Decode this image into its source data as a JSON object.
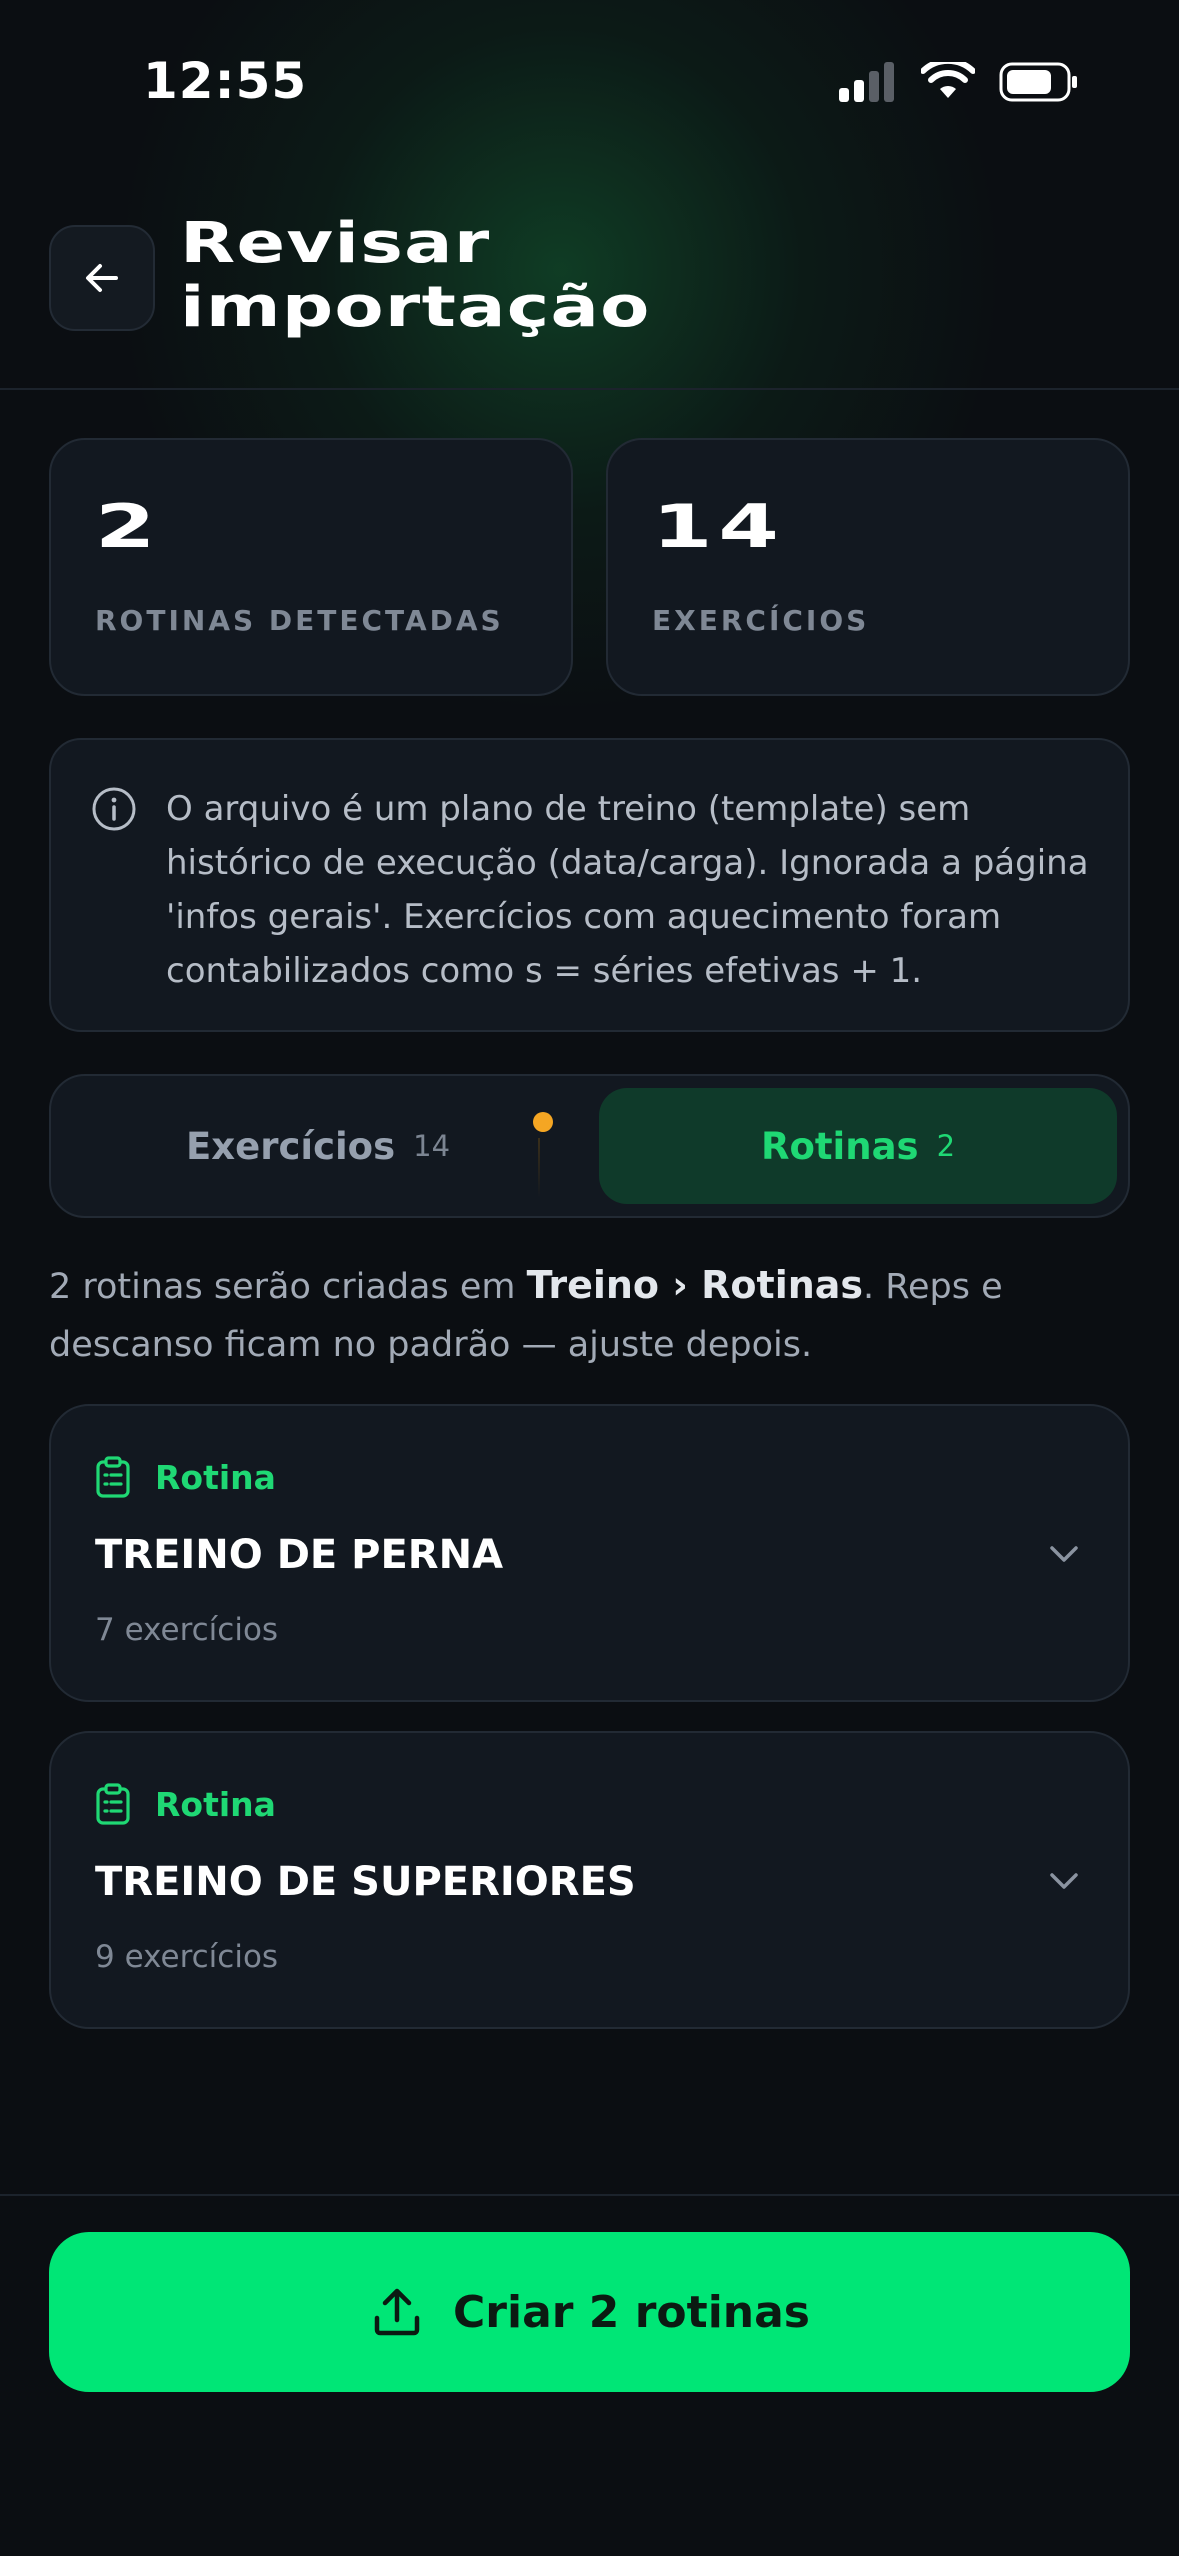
{
  "status_bar": {
    "time": "12:55"
  },
  "header": {
    "title_line1": "Revisar",
    "title_line2": "importação"
  },
  "stats": [
    {
      "value": "2",
      "label": "ROTINAS DETECTADAS"
    },
    {
      "value": "14",
      "label": "EXERCÍCIOS"
    }
  ],
  "info": {
    "text": "O arquivo é um plano de treino (template) sem histórico de execução (data/carga). Ignorada a página 'infos gerais'. Exercícios com aquecimento foram contabilizados como s = séries efetivas + 1."
  },
  "tabs": [
    {
      "label": "Exercícios",
      "count": "14",
      "active": false
    },
    {
      "label": "Rotinas",
      "count": "2",
      "active": true
    }
  ],
  "description": {
    "prefix": "2 rotinas serão criadas em ",
    "location": "Treino › Rotinas",
    "suffix": ". Reps e descanso ficam no padrão — ajuste depois."
  },
  "routines": [
    {
      "tag": "Rotina",
      "name": "TREINO DE PERNA",
      "count": "7 exercícios"
    },
    {
      "tag": "Rotina",
      "name": "TREINO DE SUPERIORES",
      "count": "9 exercícios"
    }
  ],
  "footer": {
    "button_label": "Criar 2 rotinas"
  },
  "colors": {
    "accent": "#00e676",
    "accent_text": "#1fd874",
    "background": "#0b0e12",
    "card": "#121820",
    "warning_dot": "#f5a623"
  }
}
